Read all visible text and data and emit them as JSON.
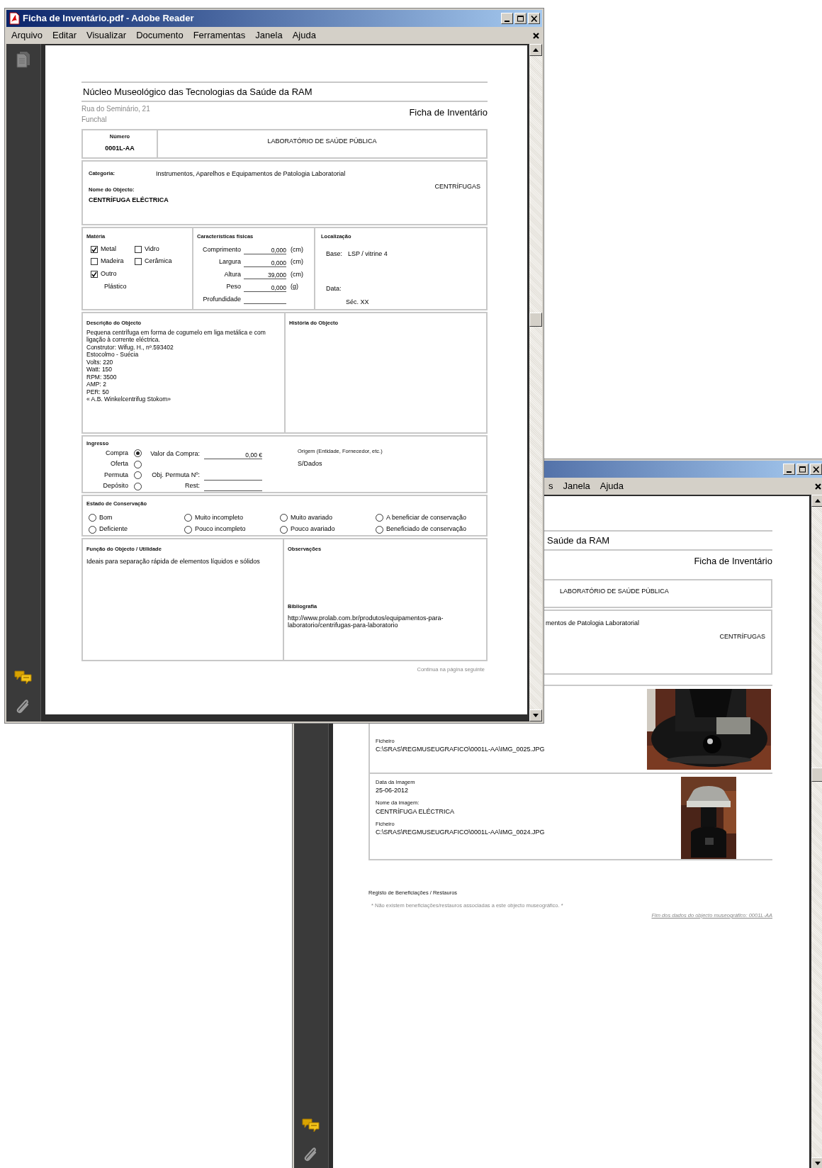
{
  "front_window": {
    "title": "Ficha de Inventário.pdf - Adobe Reader",
    "menu": [
      "Arquivo",
      "Editar",
      "Visualizar",
      "Documento",
      "Ferramentas",
      "Janela",
      "Ajuda"
    ],
    "document": {
      "institution": "Núcleo Museológico das Tecnologias da Saúde da RAM",
      "address": [
        "Rua do Seminário, 21",
        "Funchal"
      ],
      "form_title": "Ficha de Inventário",
      "numero": {
        "label": "Número",
        "value": "0001L-AA"
      },
      "section": "LABORATÓRIO DE SAÚDE PÚBLICA",
      "categoria": {
        "label": "Categoria:",
        "value": "Instrumentos, Aparelhos e Equipamentos de Patologia Laboratorial"
      },
      "nome": {
        "label": "Nome do Objecto:",
        "value": "CENTRÍFUGA ELÉCTRICA"
      },
      "tipo": "CENTRÍFUGAS",
      "materia": {
        "title": "Matéria",
        "options": [
          {
            "label": "Metal",
            "checked": true
          },
          {
            "label": "Vidro",
            "checked": false
          },
          {
            "label": "Madeira",
            "checked": false
          },
          {
            "label": "Cerâmica",
            "checked": false
          },
          {
            "label": "Outro",
            "checked": true
          }
        ],
        "other": "Plástico"
      },
      "caracteristicas": {
        "title": "Características físicas",
        "rows": [
          {
            "label": "Comprimento",
            "value": "0,000",
            "unit": "(cm)"
          },
          {
            "label": "Largura",
            "value": "0,000",
            "unit": "(cm)"
          },
          {
            "label": "Altura",
            "value": "39,000",
            "unit": "(cm)"
          },
          {
            "label": "Peso",
            "value": "0,000",
            "unit": "(g)"
          },
          {
            "label": "Profundidade"
          }
        ]
      },
      "localizacao": {
        "title": "Localização",
        "base_label": "Base:",
        "base": "LSP / vitrine 4",
        "data_label": "Data:",
        "data": "Séc. XX"
      },
      "descricao": {
        "title": "Descrição do Objecto",
        "lines": [
          "Pequena centrífuga em forma de cogumelo em liga metálica e com ligação à corrente eléctrica.",
          "Construtor: Wifug. H., nº.593402",
          "Estocolmo - Suécia",
          "Volts: 220",
          "Watt: 150",
          "RPM: 3500",
          "AMP: 2",
          "PER: 50",
          "« A.B. Winkelcentrifug Stokom»"
        ]
      },
      "historia": {
        "title": "História do Objecto"
      },
      "ingresso": {
        "title": "Ingresso",
        "options": [
          {
            "label": "Compra",
            "selected": true
          },
          {
            "label": "Oferta",
            "selected": false
          },
          {
            "label": "Permuta",
            "selected": false
          },
          {
            "label": "Depósito",
            "selected": false
          }
        ],
        "fields": [
          {
            "label": "Valor da Compra:",
            "value": "0,00 €"
          },
          {
            "label": "Obj. Permuta Nº:"
          },
          {
            "label": "Rest:"
          }
        ],
        "origem_label": "Origem (Entidade, Fornecedor, etc.)",
        "origem": "S/Dados"
      },
      "conservacao": {
        "title": "Estado de Conservação",
        "options": [
          {
            "label": "Bom",
            "selected": false
          },
          {
            "label": "Muito incompleto",
            "selected": false
          },
          {
            "label": "Muito avariado",
            "selected": false
          },
          {
            "label": "A beneficiar de conservação",
            "selected": false
          },
          {
            "label": "Deficiente",
            "selected": false
          },
          {
            "label": "Pouco incompleto",
            "selected": false
          },
          {
            "label": "Pouco avariado",
            "selected": false
          },
          {
            "label": "Beneficiado de conservação",
            "selected": false
          }
        ]
      },
      "funcao": {
        "title": "Função do Objecto / Utilidade",
        "text": "Ideais para separação rápida de elementos líquidos e sólidos"
      },
      "observacoes": {
        "title": "Observações"
      },
      "bibliografia": {
        "title": "Bibliografia",
        "text": "http://www.prolab.com.br/produtos/equipamentos-para-laboratorio/centrifugas-para-laboratorio"
      },
      "continued": "Continua na página seguinte"
    }
  },
  "back_window": {
    "menu": [
      "s",
      "Janela",
      "Ajuda"
    ],
    "document": {
      "institution": "Saúde da RAM",
      "form_title": "Ficha de Inventário",
      "section": "LABORATÓRIO DE SAÚDE PÚBLICA",
      "categoria": "mentos de Patologia Laboratorial",
      "tipo": "CENTRÍFUGAS",
      "images": [
        {
          "kind": "picture",
          "fields": [
            {
              "label": "Ficheiro",
              "value": "C:\\SRAS\\REGMUSEUGRAFICO\\0001L-AA\\IMG_0025.JPG"
            }
          ]
        },
        {
          "kind": "picture",
          "fields": [
            {
              "label": "Data da Imagem",
              "value": "25-06-2012"
            },
            {
              "label": "Nome da imagem:",
              "value": "CENTRÍFUGA ELÉCTRICA"
            },
            {
              "label": "Ficheiro",
              "value": "C:\\SRAS\\REGMUSEUGRAFICO\\0001L-AA\\IMG_0024.JPG"
            }
          ]
        }
      ],
      "registo_title": "Registo de Beneficiações / Restauros",
      "registo_note": "* Não existem beneficiações/restauros associadas a este objecto museográfico. *",
      "end_note": "Fim dos dados do objecto museográfico: 0001L-AA"
    }
  }
}
